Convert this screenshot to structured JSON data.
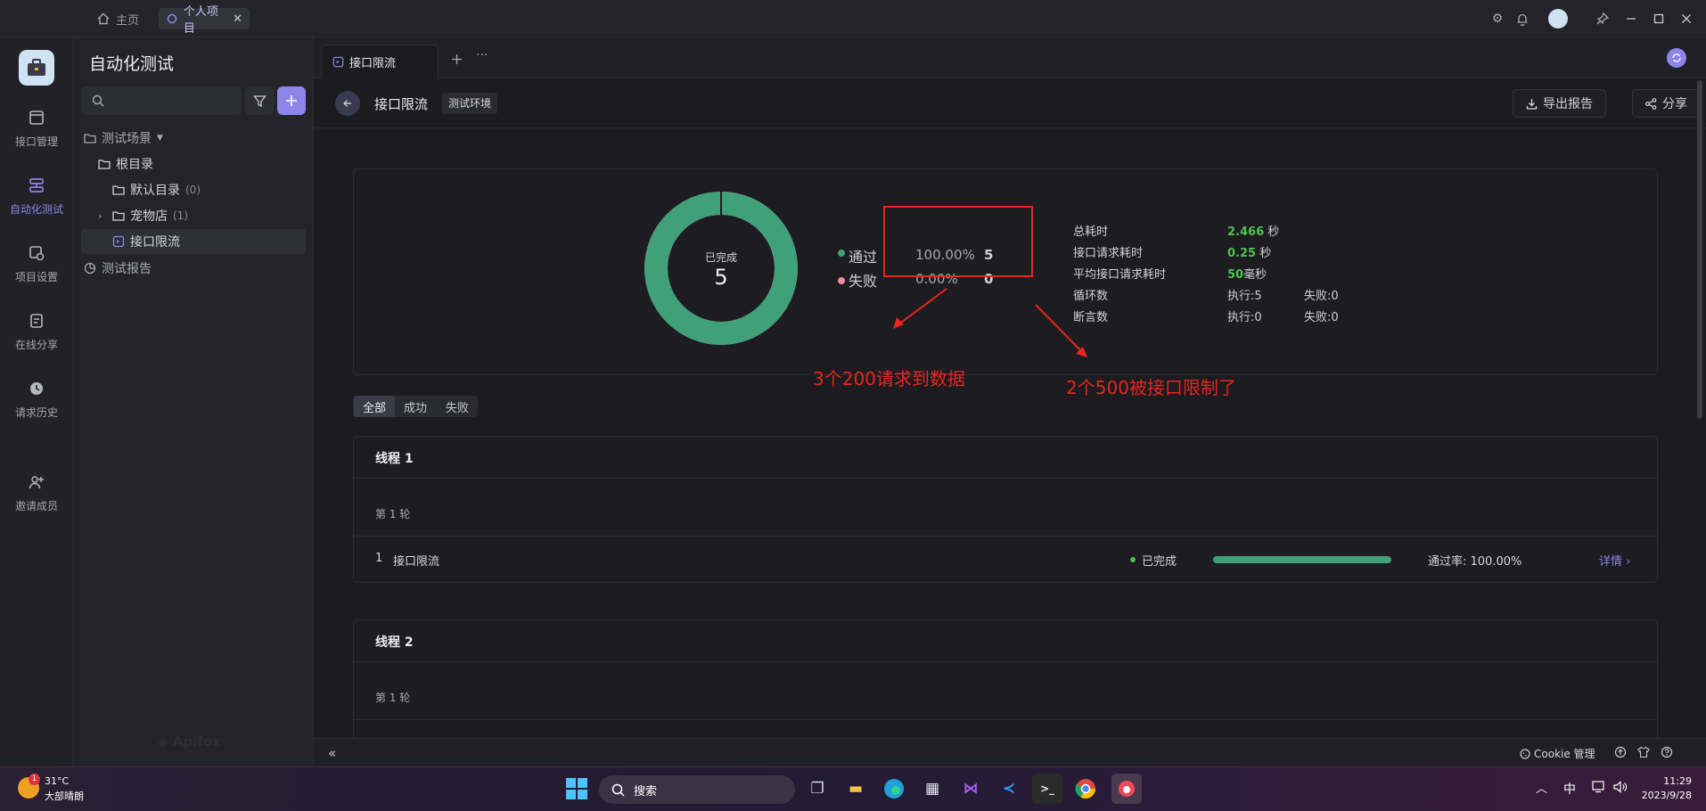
{
  "titlebar": {
    "home_label": "主页",
    "project_tab_label": "个人项目"
  },
  "rail": {
    "items": [
      {
        "label": "接口管理"
      },
      {
        "label": "自动化测试"
      },
      {
        "label": "项目设置"
      },
      {
        "label": "在线分享"
      },
      {
        "label": "请求历史"
      },
      {
        "label": "邀请成员"
      }
    ]
  },
  "sidebar": {
    "title": "自动化测试",
    "tree": {
      "scenes": "测试场景",
      "root": "根目录",
      "default_dir": "默认目录",
      "default_count": "(0)",
      "pet_store": "宠物店",
      "pet_count": "(1)",
      "rate_limit": "接口限流",
      "reports": "测试报告"
    }
  },
  "tabbar": {
    "tab_label": "接口限流"
  },
  "header": {
    "title": "接口限流",
    "env": "测试环境",
    "export_label": "导出报告",
    "share_label": "分享"
  },
  "summary": {
    "donut_label": "已完成",
    "donut_value": "5",
    "pass_label": "通过",
    "pass_pct": "100.00%",
    "pass_count": "5",
    "fail_label": "失败",
    "fail_pct": "0.00%",
    "fail_count": "0",
    "pass_ratio": 1.0,
    "stats": {
      "total_time_label": "总耗时",
      "total_time_value": "2.466",
      "total_time_unit": "秒",
      "req_time_label": "接口请求耗时",
      "req_time_value": "0.25",
      "req_time_unit": "秒",
      "avg_time_label": "平均接口请求耗时",
      "avg_time_value": "50",
      "avg_time_unit": "毫秒",
      "loops_label": "循环数",
      "loops_exec": "执行:5",
      "loops_fail": "失败:0",
      "asserts_label": "断言数",
      "asserts_exec": "执行:0",
      "asserts_fail": "失败:0"
    }
  },
  "annotations": {
    "left": "3个200请求到数据",
    "right": "2个500被接口限制了"
  },
  "filters": [
    "全部",
    "成功",
    "失败"
  ],
  "threads": [
    {
      "title": "线程 1",
      "round": "第 1 轮",
      "row_index": "1",
      "row_name": "接口限流",
      "status": "已完成",
      "progress": 1.0,
      "pass_rate": "通过率: 100.00%",
      "details": "详情 ›"
    },
    {
      "title": "线程 2",
      "round": "第 1 轮"
    }
  ],
  "bottom": {
    "cookie_label": "Cookie 管理"
  },
  "taskbar": {
    "weather_temp": "31°C",
    "weather_desc": "大部晴朗",
    "badge": "1",
    "search_label": "搜索",
    "ime": "中",
    "time": "11:29",
    "date": "2023/9/28"
  },
  "colors": {
    "accent": "#8f84ea",
    "pass_green": "#3fa07a",
    "fail_pink": "#f08aa0",
    "annotation_red": "#e8251e"
  }
}
